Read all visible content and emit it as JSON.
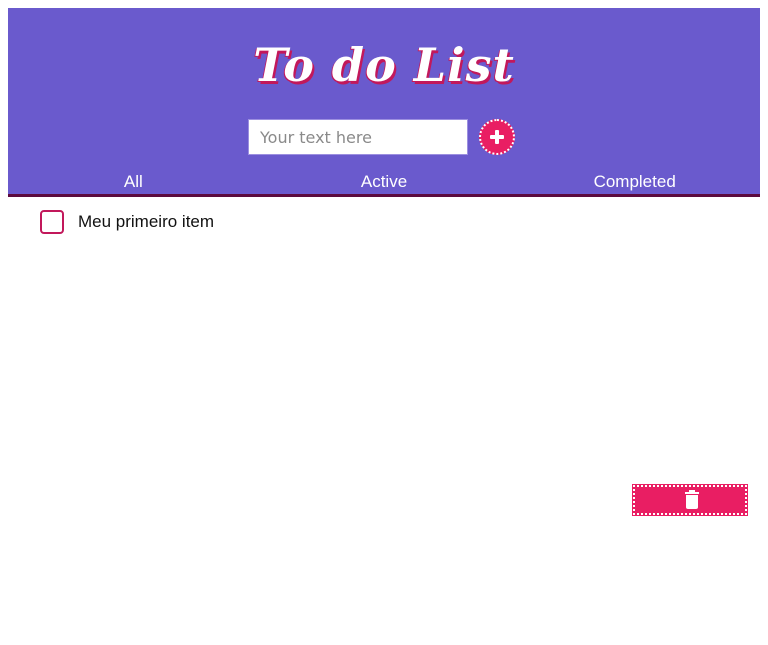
{
  "header": {
    "title": "To do List",
    "input_placeholder": "Your text here",
    "input_value": "",
    "add_button_icon": "plus-icon"
  },
  "tabs": [
    {
      "label": "All"
    },
    {
      "label": "Active"
    },
    {
      "label": "Completed"
    }
  ],
  "items": [
    {
      "label": "Meu primeiro item",
      "checked": false
    }
  ],
  "delete_button_icon": "trash-icon",
  "colors": {
    "header_bg": "#6a5acd",
    "accent": "#e91e63",
    "checkbox_border": "#c2185b",
    "header_border": "#5c0a3e"
  }
}
